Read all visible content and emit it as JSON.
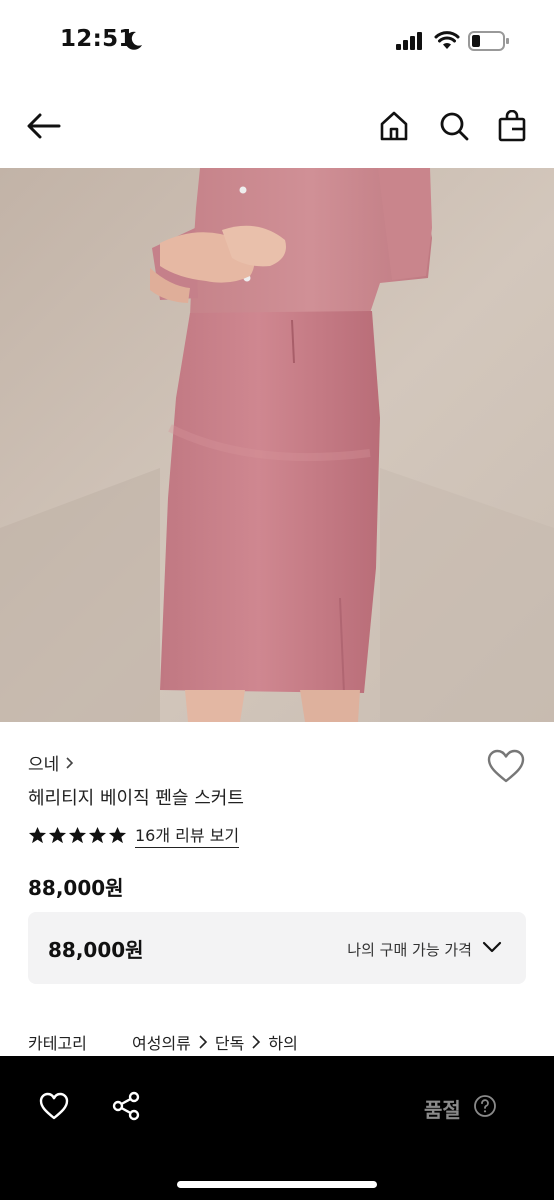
{
  "status_bar": {
    "time": "12:51"
  },
  "header": {
    "icons": [
      "back-arrow-icon",
      "home-icon",
      "search-icon",
      "shopping-bag-icon"
    ]
  },
  "product": {
    "brand": "으네",
    "name": "헤리티지 베이직 펜슬 스커트",
    "rating_stars": 5,
    "review_link_label": "16개 리뷰 보기",
    "price": "88,000원",
    "price_box": {
      "value": "88,000원",
      "label": "나의 구매 가능 가격"
    },
    "category": {
      "label": "카테고리",
      "path": [
        "여성의류",
        "단독",
        "하의"
      ]
    }
  },
  "bottom_bar": {
    "soldout_label": "품절"
  },
  "colors": {
    "skirt": "#c97b84",
    "background_wall": "#cbbdb1",
    "bottom_bar": "#000000",
    "soldout_text": "#8a8a8a"
  }
}
